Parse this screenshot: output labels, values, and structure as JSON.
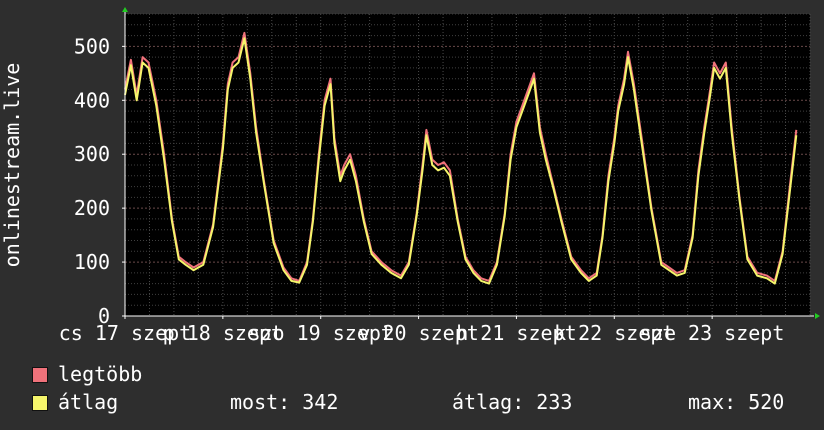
{
  "chart_data": {
    "type": "line",
    "ylabel": "onlinestream.live",
    "ylim": [
      0,
      560
    ],
    "yticks": [
      0,
      100,
      200,
      300,
      400,
      500
    ],
    "xlim": [
      0,
      7
    ],
    "xticks": [
      {
        "x": 0,
        "label": "cs 17 szept"
      },
      {
        "x": 1,
        "label": "p 18 szept"
      },
      {
        "x": 2,
        "label": "szo 19 szept"
      },
      {
        "x": 3,
        "label": "v 20 szept"
      },
      {
        "x": 4,
        "label": "h 21 szept"
      },
      {
        "x": 5,
        "label": "k 22 szept"
      },
      {
        "x": 6,
        "label": "sze 23 szept"
      }
    ],
    "grid": true,
    "x": [
      0.0,
      0.06,
      0.12,
      0.18,
      0.24,
      0.32,
      0.4,
      0.48,
      0.55,
      0.62,
      0.7,
      0.8,
      0.9,
      1.0,
      1.05,
      1.1,
      1.16,
      1.22,
      1.28,
      1.34,
      1.42,
      1.52,
      1.62,
      1.7,
      1.78,
      1.86,
      1.92,
      1.98,
      2.04,
      2.1,
      2.14,
      2.2,
      2.24,
      2.3,
      2.36,
      2.44,
      2.52,
      2.62,
      2.72,
      2.82,
      2.9,
      2.98,
      3.04,
      3.08,
      3.14,
      3.2,
      3.26,
      3.32,
      3.4,
      3.48,
      3.56,
      3.64,
      3.72,
      3.8,
      3.88,
      3.94,
      4.0,
      4.06,
      4.12,
      4.18,
      4.24,
      4.3,
      4.38,
      4.46,
      4.56,
      4.66,
      4.74,
      4.82,
      4.88,
      4.94,
      5.0,
      5.04,
      5.1,
      5.14,
      5.2,
      5.28,
      5.38,
      5.48,
      5.56,
      5.64,
      5.72,
      5.8,
      5.86,
      5.92,
      5.98,
      6.02,
      6.08,
      6.14,
      6.2,
      6.28,
      6.36,
      6.46,
      6.56,
      6.64,
      6.72,
      6.8,
      6.86
    ],
    "series": [
      {
        "name": "legtöbb",
        "color": "#f0727b",
        "values": [
          420,
          475,
          410,
          480,
          470,
          400,
          300,
          180,
          110,
          100,
          90,
          100,
          170,
          320,
          430,
          470,
          480,
          525,
          450,
          350,
          250,
          140,
          90,
          70,
          65,
          100,
          180,
          300,
          400,
          440,
          330,
          260,
          280,
          300,
          260,
          180,
          120,
          100,
          85,
          75,
          100,
          190,
          280,
          345,
          290,
          280,
          285,
          270,
          180,
          110,
          85,
          70,
          65,
          100,
          190,
          300,
          360,
          390,
          420,
          450,
          350,
          300,
          240,
          180,
          110,
          85,
          70,
          80,
          150,
          260,
          330,
          390,
          440,
          490,
          430,
          330,
          200,
          100,
          90,
          80,
          85,
          150,
          270,
          350,
          420,
          470,
          450,
          470,
          350,
          220,
          110,
          80,
          75,
          65,
          120,
          250,
          345
        ]
      },
      {
        "name": "átlag",
        "color": "#f5f56b",
        "values": [
          410,
          465,
          400,
          470,
          460,
          390,
          290,
          175,
          105,
          95,
          85,
          95,
          165,
          310,
          420,
          460,
          470,
          515,
          440,
          340,
          245,
          135,
          85,
          65,
          62,
          95,
          175,
          290,
          390,
          430,
          320,
          250,
          270,
          290,
          250,
          175,
          115,
          95,
          80,
          70,
          95,
          185,
          270,
          335,
          280,
          270,
          275,
          260,
          175,
          105,
          80,
          65,
          60,
          95,
          185,
          290,
          350,
          380,
          410,
          440,
          340,
          290,
          235,
          175,
          105,
          80,
          65,
          75,
          145,
          250,
          320,
          380,
          430,
          480,
          420,
          320,
          195,
          95,
          85,
          75,
          80,
          145,
          260,
          340,
          410,
          460,
          440,
          460,
          340,
          215,
          105,
          75,
          70,
          60,
          115,
          240,
          335
        ]
      }
    ]
  },
  "legend": [
    {
      "label": "legtöbb",
      "color": "#f0727b"
    },
    {
      "label": "átlag",
      "color": "#f5f56b"
    }
  ],
  "stats": {
    "current": "most: 342",
    "average": "átlag: 233",
    "maximum": "max: 520"
  }
}
